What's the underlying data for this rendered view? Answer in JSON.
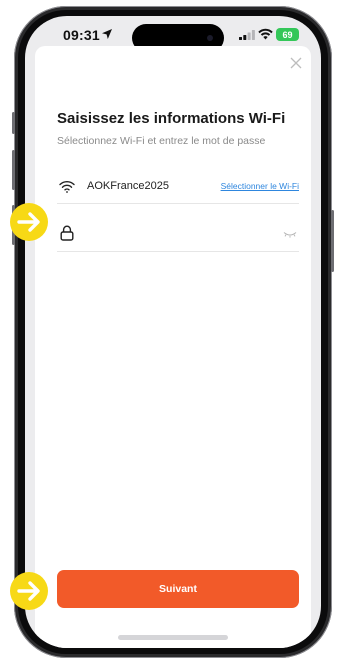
{
  "status_bar": {
    "time": "09:31",
    "battery": "69"
  },
  "sheet": {
    "title": "Saisissez les informations Wi-Fi",
    "subtitle": "Sélectionnez Wi-Fi et entrez le mot de passe",
    "wifi": {
      "ssid": "AOKFrance2025",
      "select_link": "Sélectionner le Wi-Fi"
    },
    "password": {
      "value": "",
      "placeholder": ""
    },
    "next_label": "Suivant"
  },
  "colors": {
    "accent": "#f25a29",
    "link": "#2e86de",
    "marker": "#f7d916",
    "battery": "#34c759"
  },
  "icons": [
    "location-arrow-icon",
    "cellular-signal-icon",
    "wifi-icon",
    "battery-icon",
    "close-icon",
    "lock-icon",
    "eye-closed-icon",
    "arrow-right-icon"
  ]
}
